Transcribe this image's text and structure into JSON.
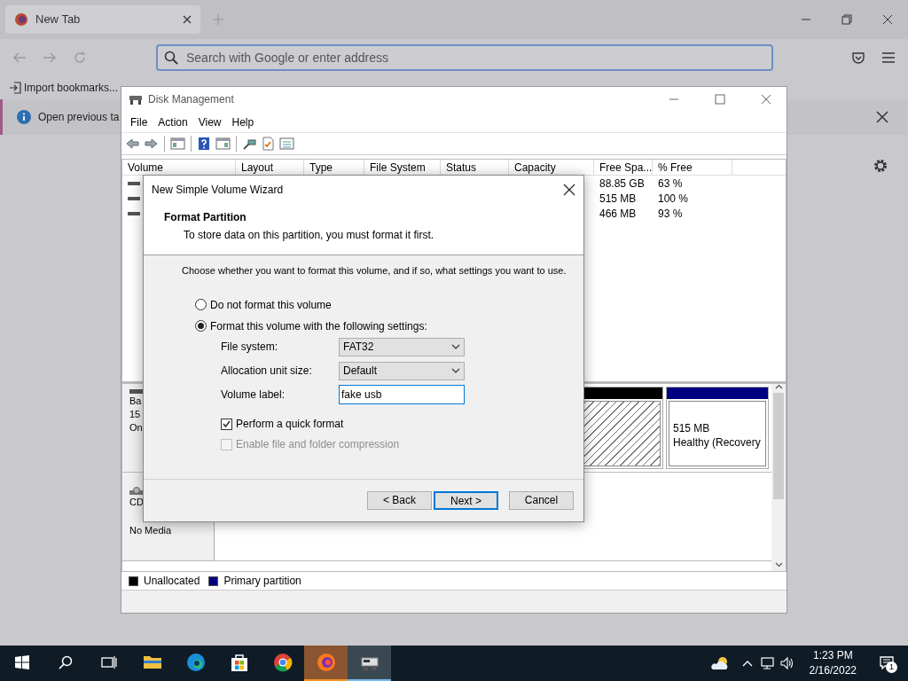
{
  "browser": {
    "tab": {
      "title": "New Tab",
      "selected": true
    },
    "address_bar": {
      "placeholder": "Search with Google or enter address"
    },
    "bookmarks": [
      {
        "label": "Import bookmarks..."
      }
    ],
    "notification": {
      "text": "Open previous ta"
    }
  },
  "disk_management": {
    "title": "Disk Management",
    "menu": [
      "File",
      "Action",
      "View",
      "Help"
    ],
    "columns": [
      "Volume",
      "Layout",
      "Type",
      "File System",
      "Status",
      "Capacity",
      "Free Spa...",
      "% Free"
    ],
    "rows": [
      {
        "free_space": "88.85 GB",
        "percent_free": "63 %"
      },
      {
        "free_space": "515 MB",
        "percent_free": "100 %"
      },
      {
        "free_space": "466 MB",
        "percent_free": "93 %"
      }
    ],
    "disks": [
      {
        "kind": "disk",
        "lines": [
          "Ba",
          "15",
          "On"
        ],
        "partitions": [
          {
            "kind": "unallocated"
          },
          {
            "kind": "primary",
            "size": "515 MB",
            "status": "Healthy (Recovery"
          }
        ]
      },
      {
        "kind": "cdrom",
        "lines": [
          "CD",
          "No Media"
        ]
      }
    ],
    "legend": [
      {
        "label": "Unallocated",
        "color": "#000000"
      },
      {
        "label": "Primary partition",
        "color": "#000080"
      }
    ]
  },
  "wizard": {
    "title": "New Simple Volume Wizard",
    "heading": "Format Partition",
    "subheading": "To store data on this partition, you must format it first.",
    "instruction": "Choose whether you want to format this volume, and if so, what settings you want to use.",
    "options": [
      {
        "label": "Do not format this volume",
        "selected": false
      },
      {
        "label": "Format this volume with the following settings:",
        "selected": true
      }
    ],
    "fields": [
      {
        "label": "File system:",
        "kind": "select",
        "value": "FAT32"
      },
      {
        "label": "Allocation unit size:",
        "kind": "select",
        "value": "Default"
      },
      {
        "label": "Volume label:",
        "kind": "text",
        "value": "fake usb"
      }
    ],
    "checkboxes": [
      {
        "label": "Perform a quick format",
        "checked": true,
        "disabled": false
      },
      {
        "label": "Enable file and folder compression",
        "checked": false,
        "disabled": true
      }
    ],
    "buttons": [
      {
        "label": "< Back",
        "default": false
      },
      {
        "label": "Next >",
        "default": true
      },
      {
        "label": "Cancel",
        "default": false
      }
    ]
  },
  "taskbar": {
    "apps": [
      {
        "kind": "folder",
        "selected": false,
        "attention": false
      },
      {
        "kind": "edge",
        "selected": false,
        "attention": false
      },
      {
        "kind": "store",
        "selected": false,
        "attention": false
      },
      {
        "kind": "chrome",
        "selected": false,
        "attention": false
      },
      {
        "kind": "firefox",
        "selected": false,
        "attention": true
      },
      {
        "kind": "disk",
        "selected": true,
        "attention": false
      }
    ],
    "time": "1:23 PM",
    "date": "2/16/2022",
    "notification_count": "1"
  }
}
